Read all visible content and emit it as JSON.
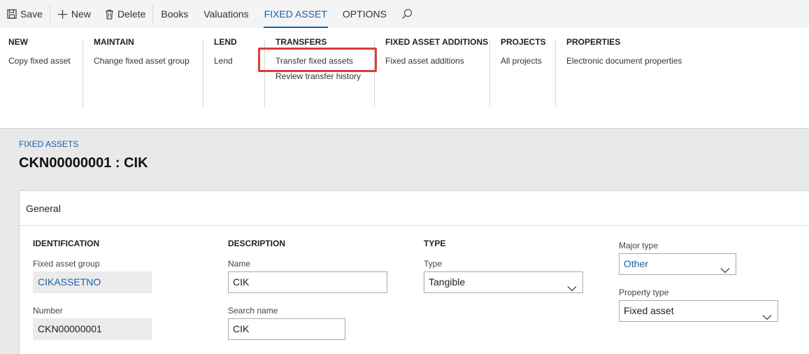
{
  "actionbar": {
    "save": "Save",
    "new": "New",
    "delete": "Delete",
    "tabs": [
      "Books",
      "Valuations",
      "FIXED ASSET",
      "OPTIONS"
    ],
    "active_tab": "FIXED ASSET",
    "icons": {
      "save": "save-icon",
      "new": "plus-icon",
      "delete": "trash-icon",
      "search": "search-icon"
    }
  },
  "ribbon": {
    "groups": [
      {
        "header": "NEW",
        "items": [
          "Copy fixed asset"
        ]
      },
      {
        "header": "MAINTAIN",
        "items": [
          "Change fixed asset group"
        ]
      },
      {
        "header": "LEND",
        "items": [
          "Lend"
        ]
      },
      {
        "header": "TRANSFERS",
        "items": [
          "Transfer fixed assets",
          "Review transfer history"
        ]
      },
      {
        "header": "FIXED ASSET ADDITIONS",
        "items": [
          "Fixed asset additions"
        ]
      },
      {
        "header": "PROJECTS",
        "items": [
          "All projects"
        ]
      },
      {
        "header": "PROPERTIES",
        "items": [
          "Electronic document properties"
        ]
      }
    ],
    "highlight_color": "#d9403a"
  },
  "page": {
    "breadcrumb": "FIXED ASSETS",
    "title": "CKN00000001 : CIK"
  },
  "general": {
    "header": "General",
    "identification": {
      "heading": "IDENTIFICATION",
      "group_label": "Fixed asset group",
      "group_value": "CIKASSETNO",
      "number_label": "Number",
      "number_value": "CKN00000001"
    },
    "description": {
      "heading": "DESCRIPTION",
      "name_label": "Name",
      "name_value": "CIK",
      "search_label": "Search name",
      "search_value": "CIK"
    },
    "type": {
      "heading": "TYPE",
      "type_label": "Type",
      "type_value": "Tangible"
    },
    "other": {
      "major_label": "Major type",
      "major_value": "Other",
      "property_label": "Property type",
      "property_value": "Fixed asset"
    }
  },
  "colors": {
    "accent": "#1a5fa8",
    "actionbar_bg": "#f4f4f4",
    "page_bg": "#e9e9e9"
  }
}
